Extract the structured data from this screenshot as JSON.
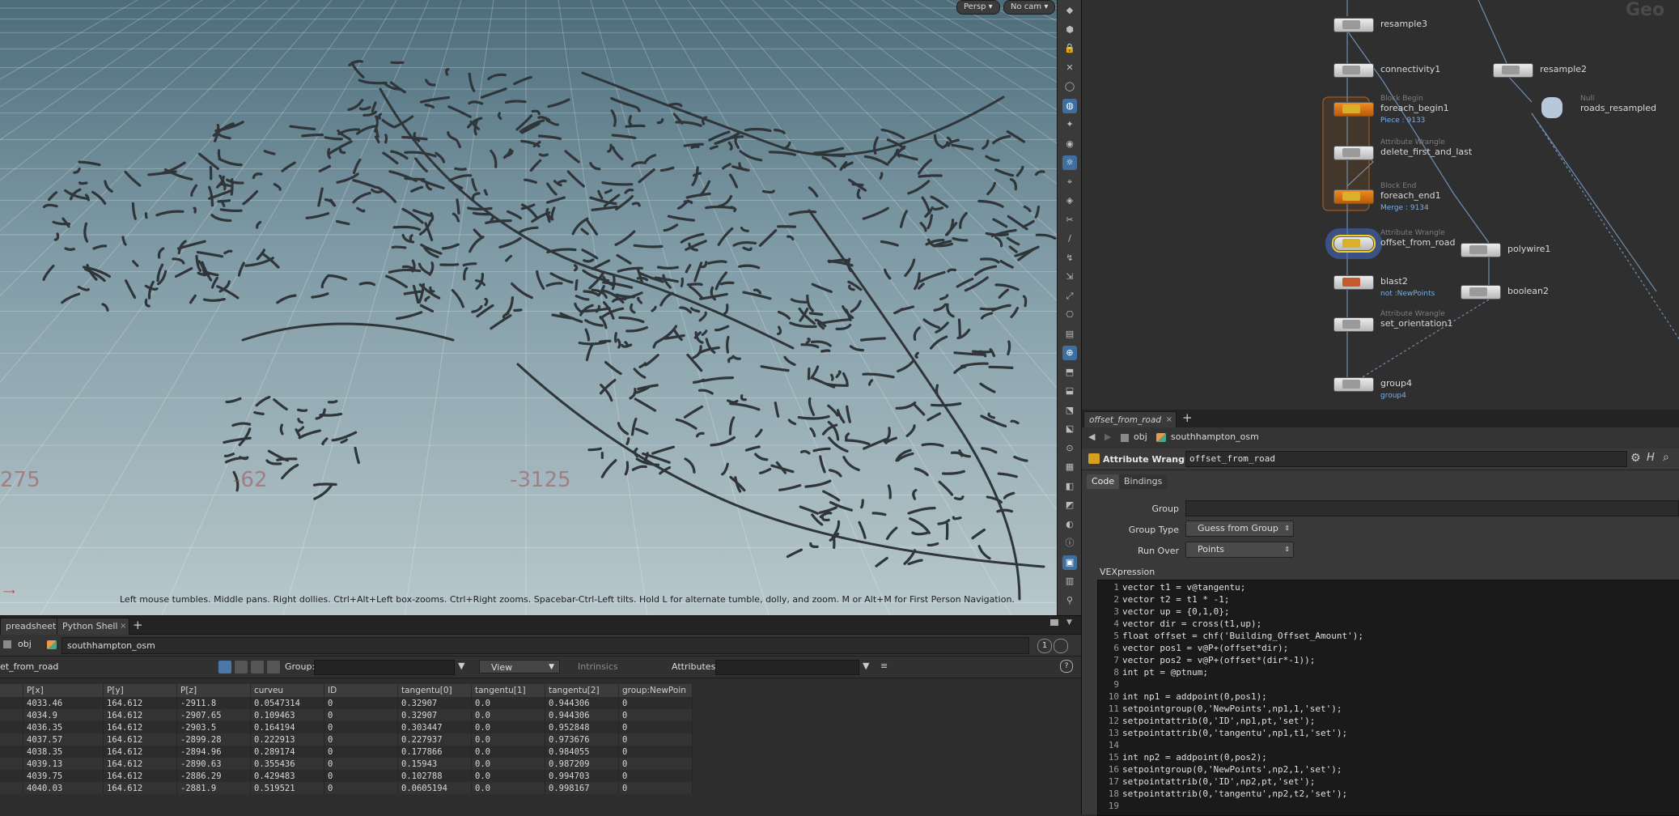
{
  "viewport": {
    "persp_label": "Persp",
    "cam_label": "No cam",
    "hint": "Left mouse tumbles. Middle pans. Right dollies. Ctrl+Alt+Left box-zooms. Ctrl+Right zooms. Spacebar-Ctrl-Left tilts. Hold L for alternate tumble, dolly, and zoom.     M or Alt+M for First Person Navigation.",
    "grid_labels": [
      "275",
      "-62",
      "-3125"
    ]
  },
  "spreadsheet": {
    "tabs": [
      {
        "label": "preadsheet"
      },
      {
        "label": "Python Shell"
      }
    ],
    "path_obj": "obj",
    "path_node": "southhampton_osm",
    "node_name": "et_from_road",
    "group_label": "Group:",
    "view_label": "View",
    "intrinsics_label": "Intrinsics",
    "attributes_label": "Attributes:",
    "page_num": "1",
    "columns": [
      "P[x]",
      "P[y]",
      "P[z]",
      "curveu",
      "ID",
      "tangentu[0]",
      "tangentu[1]",
      "tangentu[2]",
      "group:NewPoin"
    ],
    "rows": [
      [
        "4033.46",
        "164.612",
        "-2911.8",
        "0.0547314",
        "0",
        "0.32907",
        "0.0",
        "0.944306",
        "0"
      ],
      [
        "4034.9",
        "164.612",
        "-2907.65",
        "0.109463",
        "0",
        "0.32907",
        "0.0",
        "0.944306",
        "0"
      ],
      [
        "4036.35",
        "164.612",
        "-2903.5",
        "0.164194",
        "0",
        "0.303447",
        "0.0",
        "0.952848",
        "0"
      ],
      [
        "4037.57",
        "164.612",
        "-2899.28",
        "0.222913",
        "0",
        "0.227937",
        "0.0",
        "0.973676",
        "0"
      ],
      [
        "4038.35",
        "164.612",
        "-2894.96",
        "0.289174",
        "0",
        "0.177866",
        "0.0",
        "0.984055",
        "0"
      ],
      [
        "4039.13",
        "164.612",
        "-2890.63",
        "0.355436",
        "0",
        "0.15943",
        "0.0",
        "0.987209",
        "0"
      ],
      [
        "4039.75",
        "164.612",
        "-2886.29",
        "0.429483",
        "0",
        "0.102788",
        "0.0",
        "0.994703",
        "0"
      ],
      [
        "4040.03",
        "164.612",
        "-2881.9",
        "0.519521",
        "0",
        "0.0605194",
        "0.0",
        "0.998167",
        "0"
      ]
    ]
  },
  "network": {
    "corner_label": "Geo",
    "nodes": [
      {
        "name": "resample3",
        "sub": "",
        "info": ""
      },
      {
        "name": "connectivity1",
        "sub": "",
        "info": ""
      },
      {
        "name": "foreach_begin1",
        "sub": "Block Begin",
        "info": "Piece : 9133"
      },
      {
        "name": "delete_first_and_last",
        "sub": "Attribute Wrangle",
        "info": ""
      },
      {
        "name": "foreach_end1",
        "sub": "Block End",
        "info": "Merge : 9134"
      },
      {
        "name": "offset_from_road",
        "sub": "Attribute Wrangle",
        "info": ""
      },
      {
        "name": "blast2",
        "sub": "",
        "info": "not :NewPoints"
      },
      {
        "name": "set_orientation1",
        "sub": "Attribute Wrangle",
        "info": ""
      },
      {
        "name": "group4",
        "sub": "",
        "info": "group4"
      },
      {
        "name": "resample2",
        "sub": "",
        "info": ""
      },
      {
        "name": "roads_resampled",
        "sub": "Null",
        "info": ""
      },
      {
        "name": "polywire1",
        "sub": "",
        "info": ""
      },
      {
        "name": "boolean2",
        "sub": "",
        "info": ""
      }
    ]
  },
  "params": {
    "tab_label": "offset_from_road",
    "path_obj": "obj",
    "path_node": "southhampton_osm",
    "node_type": "Attribute Wrangle",
    "node_name": "offset_from_road",
    "tabs": [
      "Code",
      "Bindings"
    ],
    "group_label": "Group",
    "group_type_label": "Group Type",
    "group_type_value": "Guess from Group",
    "run_over_label": "Run Over",
    "run_over_value": "Points",
    "vexpression_label": "VEXpression",
    "code_lines": [
      "vector t1 = v@tangentu;",
      "vector t2 = t1 * -1;",
      "vector up = {0,1,0};",
      "vector dir = cross(t1,up);",
      "float offset = chf('Building_Offset_Amount');",
      "vector pos1 = v@P+(offset*dir);",
      "vector pos2 = v@P+(offset*(dir*-1));",
      "int pt = @ptnum;",
      "",
      "int np1 = addpoint(0,pos1);",
      "setpointgroup(0,'NewPoints',np1,1,'set');",
      "setpointattrib(0,'ID',np1,pt,'set');",
      "setpointattrib(0,'tangentu',np1,t1,'set');",
      "",
      "int np2 = addpoint(0,pos2);",
      "setpointgroup(0,'NewPoints',np2,1,'set');",
      "setpointattrib(0,'ID',np2,pt,'set');",
      "setpointattrib(0,'tangentu',np2,t2,'set');",
      ""
    ]
  }
}
